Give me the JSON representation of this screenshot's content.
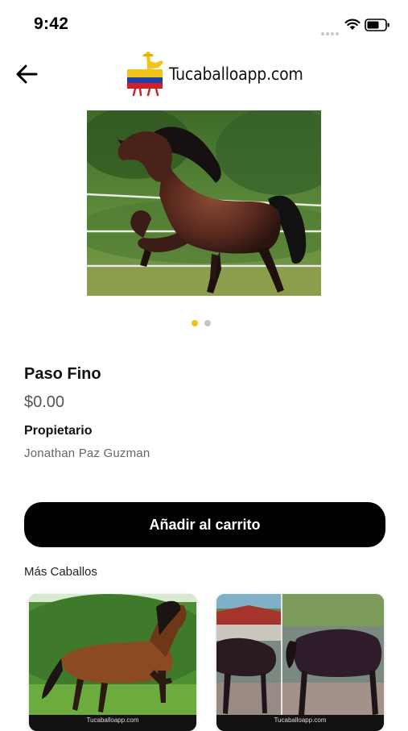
{
  "status_bar": {
    "time": "9:42"
  },
  "header": {
    "logo_text": "Tucaballoapp.com"
  },
  "product": {
    "name": "Paso Fino",
    "price": "$0.00",
    "owner_label": "Propietario",
    "owner_name": "Jonathan Paz Guzman"
  },
  "carousel": {
    "total_slides": 2,
    "active_index": 0,
    "active_color": "#f2c318",
    "inactive_color": "#c4c4c4"
  },
  "actions": {
    "add_to_cart": "Añadir al carrito"
  },
  "more": {
    "title": "Más Caballos",
    "cards": [
      {
        "caption": "Tucaballoapp.com"
      },
      {
        "caption": "Tucaballoapp.com"
      }
    ]
  },
  "icons": {
    "back": "arrow-left-icon",
    "wifi": "wifi-icon",
    "battery": "battery-icon",
    "signal": "cellular-signal-icon"
  }
}
